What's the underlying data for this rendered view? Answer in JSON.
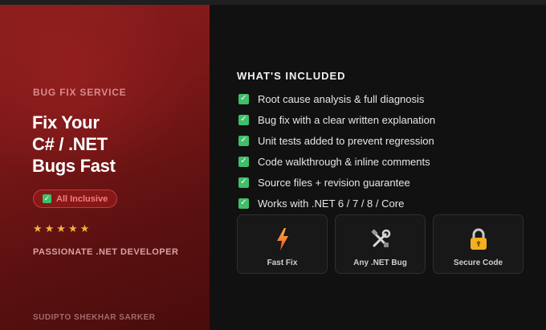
{
  "left": {
    "kicker": "BUG FIX SERVICE",
    "title_line1": "Fix Your",
    "title_line2": "C# / .NET",
    "title_line3": "Bugs Fast",
    "badge": "All Inclusive",
    "stars": "★★★★★",
    "role": "PASSIONATE .NET DEVELOPER",
    "author": "SUDIPTO SHEKHAR SARKER"
  },
  "right": {
    "section_title": "WHAT'S INCLUDED",
    "features": [
      "Root cause analysis & full diagnosis",
      "Bug fix with a clear written explanation",
      "Unit tests added to prevent regression",
      "Code walkthrough & inline comments",
      "Source files + revision guarantee",
      "Works with .NET 6 / 7 / 8 / Core"
    ],
    "cards": [
      {
        "label": "Fast Fix",
        "icon": "lightning-icon"
      },
      {
        "label": "Any .NET Bug",
        "icon": "tools-icon"
      },
      {
        "label": "Secure Code",
        "icon": "lock-icon"
      }
    ]
  },
  "colors": {
    "accent_red": "#8c1e1e",
    "check_green": "#3fbf6a",
    "star_gold": "#f3b33a",
    "badge_text": "#ff7a7a"
  }
}
